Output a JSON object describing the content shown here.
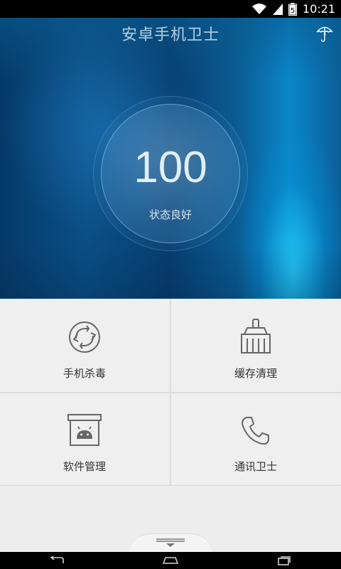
{
  "status_bar": {
    "time": "10:21",
    "battery_level": "5"
  },
  "app": {
    "title": "安卓手机卫士"
  },
  "score": {
    "value": "100",
    "status": "状态良好"
  },
  "tiles": [
    {
      "label": "手机杀毒",
      "icon": "refresh-virus-icon"
    },
    {
      "label": "缓存清理",
      "icon": "broom-icon"
    },
    {
      "label": "软件管理",
      "icon": "android-box-icon"
    },
    {
      "label": "通讯卫士",
      "icon": "phone-icon"
    }
  ],
  "colors": {
    "hero_accent": "#0a86c8",
    "panel_bg": "#efefef",
    "icon_stroke": "#666666"
  }
}
